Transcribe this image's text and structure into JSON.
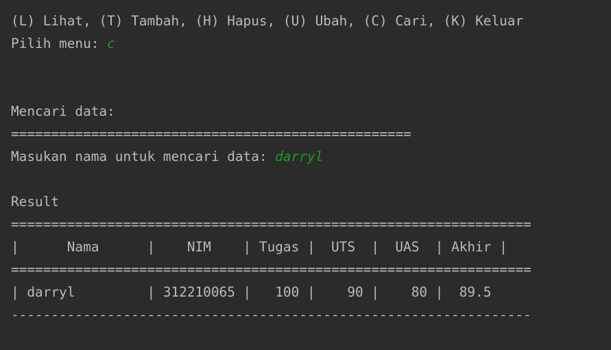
{
  "console": {
    "menu_line": "(L) Lihat, (T) Tambah, (H) Hapus, (U) Ubah, (C) Cari, (K) Keluar",
    "menu_prompt": "Pilih menu: ",
    "menu_input": "c",
    "search_heading": "Mencari data:",
    "separator_short": "==================================================",
    "search_prompt": "Masukan nama untuk mencari data: ",
    "search_input": "darryl",
    "result_heading": "Result",
    "table": {
      "separator": "=================================================================",
      "header_row": "|      Nama      |    NIM    | Tugas |  UTS  |  UAS  | Akhir |",
      "rows": [
        "| darryl         | 312210065 |   100 |    90 |    80 |  89.5"
      ],
      "footer_separator": "-----------------------------------------------------------------"
    }
  },
  "colors": {
    "background": "#2b2b2b",
    "text": "#bbbbbb",
    "user_input": "#1f9b1f"
  }
}
